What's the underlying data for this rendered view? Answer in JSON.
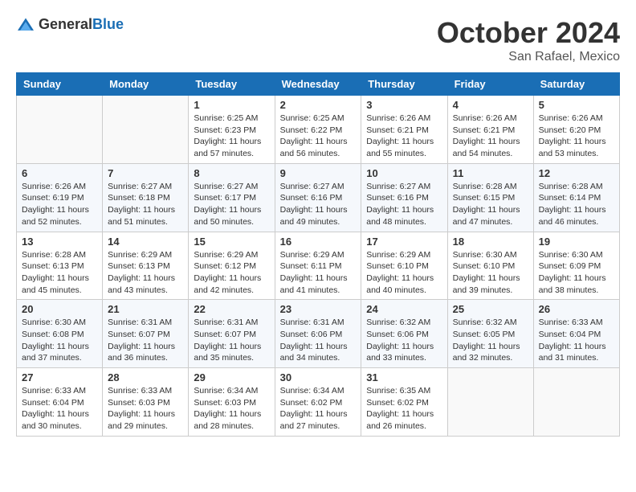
{
  "header": {
    "logo_general": "General",
    "logo_blue": "Blue",
    "month": "October 2024",
    "location": "San Rafael, Mexico"
  },
  "weekdays": [
    "Sunday",
    "Monday",
    "Tuesday",
    "Wednesday",
    "Thursday",
    "Friday",
    "Saturday"
  ],
  "weeks": [
    [
      {
        "day": "",
        "sunrise": "",
        "sunset": "",
        "daylight": ""
      },
      {
        "day": "",
        "sunrise": "",
        "sunset": "",
        "daylight": ""
      },
      {
        "day": "1",
        "sunrise": "Sunrise: 6:25 AM",
        "sunset": "Sunset: 6:23 PM",
        "daylight": "Daylight: 11 hours and 57 minutes."
      },
      {
        "day": "2",
        "sunrise": "Sunrise: 6:25 AM",
        "sunset": "Sunset: 6:22 PM",
        "daylight": "Daylight: 11 hours and 56 minutes."
      },
      {
        "day": "3",
        "sunrise": "Sunrise: 6:26 AM",
        "sunset": "Sunset: 6:21 PM",
        "daylight": "Daylight: 11 hours and 55 minutes."
      },
      {
        "day": "4",
        "sunrise": "Sunrise: 6:26 AM",
        "sunset": "Sunset: 6:21 PM",
        "daylight": "Daylight: 11 hours and 54 minutes."
      },
      {
        "day": "5",
        "sunrise": "Sunrise: 6:26 AM",
        "sunset": "Sunset: 6:20 PM",
        "daylight": "Daylight: 11 hours and 53 minutes."
      }
    ],
    [
      {
        "day": "6",
        "sunrise": "Sunrise: 6:26 AM",
        "sunset": "Sunset: 6:19 PM",
        "daylight": "Daylight: 11 hours and 52 minutes."
      },
      {
        "day": "7",
        "sunrise": "Sunrise: 6:27 AM",
        "sunset": "Sunset: 6:18 PM",
        "daylight": "Daylight: 11 hours and 51 minutes."
      },
      {
        "day": "8",
        "sunrise": "Sunrise: 6:27 AM",
        "sunset": "Sunset: 6:17 PM",
        "daylight": "Daylight: 11 hours and 50 minutes."
      },
      {
        "day": "9",
        "sunrise": "Sunrise: 6:27 AM",
        "sunset": "Sunset: 6:16 PM",
        "daylight": "Daylight: 11 hours and 49 minutes."
      },
      {
        "day": "10",
        "sunrise": "Sunrise: 6:27 AM",
        "sunset": "Sunset: 6:16 PM",
        "daylight": "Daylight: 11 hours and 48 minutes."
      },
      {
        "day": "11",
        "sunrise": "Sunrise: 6:28 AM",
        "sunset": "Sunset: 6:15 PM",
        "daylight": "Daylight: 11 hours and 47 minutes."
      },
      {
        "day": "12",
        "sunrise": "Sunrise: 6:28 AM",
        "sunset": "Sunset: 6:14 PM",
        "daylight": "Daylight: 11 hours and 46 minutes."
      }
    ],
    [
      {
        "day": "13",
        "sunrise": "Sunrise: 6:28 AM",
        "sunset": "Sunset: 6:13 PM",
        "daylight": "Daylight: 11 hours and 45 minutes."
      },
      {
        "day": "14",
        "sunrise": "Sunrise: 6:29 AM",
        "sunset": "Sunset: 6:13 PM",
        "daylight": "Daylight: 11 hours and 43 minutes."
      },
      {
        "day": "15",
        "sunrise": "Sunrise: 6:29 AM",
        "sunset": "Sunset: 6:12 PM",
        "daylight": "Daylight: 11 hours and 42 minutes."
      },
      {
        "day": "16",
        "sunrise": "Sunrise: 6:29 AM",
        "sunset": "Sunset: 6:11 PM",
        "daylight": "Daylight: 11 hours and 41 minutes."
      },
      {
        "day": "17",
        "sunrise": "Sunrise: 6:29 AM",
        "sunset": "Sunset: 6:10 PM",
        "daylight": "Daylight: 11 hours and 40 minutes."
      },
      {
        "day": "18",
        "sunrise": "Sunrise: 6:30 AM",
        "sunset": "Sunset: 6:10 PM",
        "daylight": "Daylight: 11 hours and 39 minutes."
      },
      {
        "day": "19",
        "sunrise": "Sunrise: 6:30 AM",
        "sunset": "Sunset: 6:09 PM",
        "daylight": "Daylight: 11 hours and 38 minutes."
      }
    ],
    [
      {
        "day": "20",
        "sunrise": "Sunrise: 6:30 AM",
        "sunset": "Sunset: 6:08 PM",
        "daylight": "Daylight: 11 hours and 37 minutes."
      },
      {
        "day": "21",
        "sunrise": "Sunrise: 6:31 AM",
        "sunset": "Sunset: 6:07 PM",
        "daylight": "Daylight: 11 hours and 36 minutes."
      },
      {
        "day": "22",
        "sunrise": "Sunrise: 6:31 AM",
        "sunset": "Sunset: 6:07 PM",
        "daylight": "Daylight: 11 hours and 35 minutes."
      },
      {
        "day": "23",
        "sunrise": "Sunrise: 6:31 AM",
        "sunset": "Sunset: 6:06 PM",
        "daylight": "Daylight: 11 hours and 34 minutes."
      },
      {
        "day": "24",
        "sunrise": "Sunrise: 6:32 AM",
        "sunset": "Sunset: 6:06 PM",
        "daylight": "Daylight: 11 hours and 33 minutes."
      },
      {
        "day": "25",
        "sunrise": "Sunrise: 6:32 AM",
        "sunset": "Sunset: 6:05 PM",
        "daylight": "Daylight: 11 hours and 32 minutes."
      },
      {
        "day": "26",
        "sunrise": "Sunrise: 6:33 AM",
        "sunset": "Sunset: 6:04 PM",
        "daylight": "Daylight: 11 hours and 31 minutes."
      }
    ],
    [
      {
        "day": "27",
        "sunrise": "Sunrise: 6:33 AM",
        "sunset": "Sunset: 6:04 PM",
        "daylight": "Daylight: 11 hours and 30 minutes."
      },
      {
        "day": "28",
        "sunrise": "Sunrise: 6:33 AM",
        "sunset": "Sunset: 6:03 PM",
        "daylight": "Daylight: 11 hours and 29 minutes."
      },
      {
        "day": "29",
        "sunrise": "Sunrise: 6:34 AM",
        "sunset": "Sunset: 6:03 PM",
        "daylight": "Daylight: 11 hours and 28 minutes."
      },
      {
        "day": "30",
        "sunrise": "Sunrise: 6:34 AM",
        "sunset": "Sunset: 6:02 PM",
        "daylight": "Daylight: 11 hours and 27 minutes."
      },
      {
        "day": "31",
        "sunrise": "Sunrise: 6:35 AM",
        "sunset": "Sunset: 6:02 PM",
        "daylight": "Daylight: 11 hours and 26 minutes."
      },
      {
        "day": "",
        "sunrise": "",
        "sunset": "",
        "daylight": ""
      },
      {
        "day": "",
        "sunrise": "",
        "sunset": "",
        "daylight": ""
      }
    ]
  ]
}
